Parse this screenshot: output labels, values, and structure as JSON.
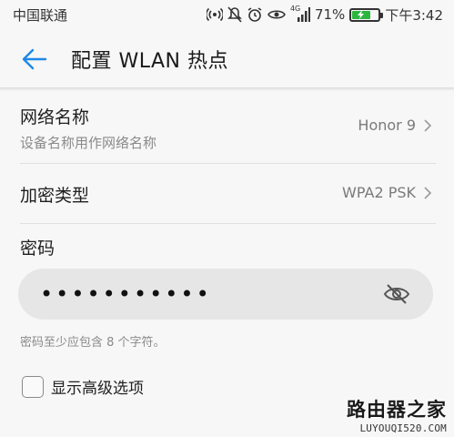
{
  "status_bar": {
    "carrier": "中国联通",
    "network": "4G",
    "battery_percent": "71%",
    "battery_level": 0.71,
    "time": "下午3:42",
    "icons": [
      "hotspot-icon",
      "mute-icon",
      "alarm-icon",
      "eye-comfort-icon",
      "signal-icon",
      "battery-charging-icon"
    ]
  },
  "header": {
    "title": "配置 WLAN 热点",
    "back_icon": "back-arrow-icon"
  },
  "network_name": {
    "label": "网络名称",
    "subtitle": "设备名称用作网络名称",
    "value": "Honor 9"
  },
  "encryption": {
    "label": "加密类型",
    "value": "WPA2 PSK"
  },
  "password": {
    "label": "密码",
    "masked_value": "•••••••••••",
    "hint": "密码至少应包含 8 个字符。"
  },
  "show_advanced": {
    "label": "显示高级选项",
    "checked": false
  },
  "watermark": {
    "title": "路由器之家",
    "url": "LUYOUQI520.COM"
  },
  "colors": {
    "accent": "#1e88e5",
    "battery": "#2cb53f"
  }
}
